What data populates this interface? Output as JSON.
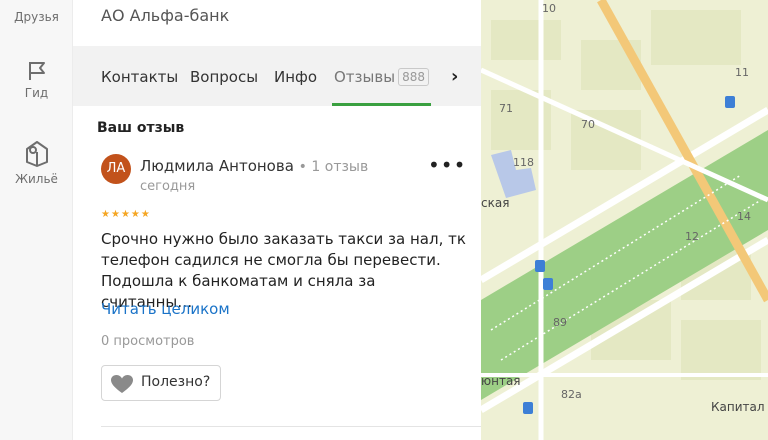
{
  "sidebar": {
    "items": [
      {
        "label": "Друзья",
        "icon": "friends-icon"
      },
      {
        "label": "Гид",
        "icon": "flag-icon"
      },
      {
        "label": "Жильё",
        "icon": "housing-icon"
      }
    ]
  },
  "panel": {
    "organization": "АО Альфа-банк",
    "tabs": [
      {
        "label": "Контакты"
      },
      {
        "label": "Вопросы"
      },
      {
        "label": "Инфо"
      },
      {
        "label": "Отзывы",
        "count": "888",
        "active": true
      }
    ]
  },
  "review": {
    "section_title": "Ваш отзыв",
    "avatar_initials": "ЛА",
    "author": "Людмила Антонова",
    "author_reviews": "1 отзыв",
    "date": "сегодня",
    "rating": 5,
    "text_lines": [
      "Срочно нужно было заказать такси за нал, тк",
      "телефон садился не смогла бы перевести.",
      "Подошла к банкоматам и сняла за считанны…"
    ],
    "read_more": "Читать целиком",
    "views": "0 просмотров",
    "useful_label": "Полезно?"
  },
  "map": {
    "labels": [
      {
        "text": "10"
      },
      {
        "text": "11"
      },
      {
        "text": "71"
      },
      {
        "text": "70"
      },
      {
        "text": "118"
      },
      {
        "text": "12"
      },
      {
        "text": "14"
      },
      {
        "text": "89"
      },
      {
        "text": "82а"
      }
    ],
    "streets": [
      {
        "text": "ская"
      },
      {
        "text": "юнтая"
      },
      {
        "text": "Капитал"
      }
    ],
    "colors": {
      "background": "#eef0d4",
      "park": "#9dcf86",
      "road_major": "#f3c878",
      "road": "#ffffff"
    }
  },
  "colors": {
    "accent": "#3aa040",
    "link": "#1a73c8",
    "avatar": "#c2521b",
    "star": "#f5a623"
  }
}
